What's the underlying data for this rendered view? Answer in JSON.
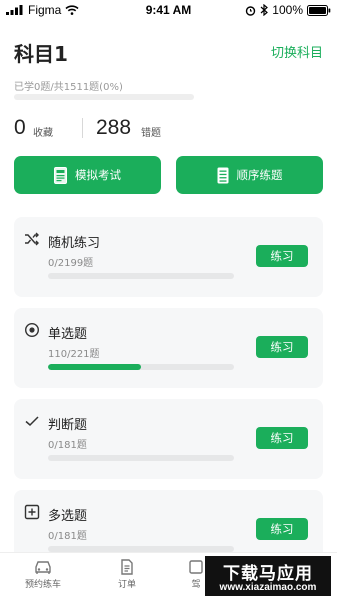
{
  "status_bar": {
    "carrier": "Figma",
    "time": "9:41 AM",
    "battery": "100%"
  },
  "header": {
    "title": "科目1",
    "switch_label": "切换科目",
    "progress_text": "已学0题/共1511题(0%)",
    "progress": 0
  },
  "stats": {
    "favorites_count": "0",
    "favorites_label": "收藏",
    "wrong_count": "288",
    "wrong_label": "错题"
  },
  "actions": {
    "mock_exam_label": "模拟考试",
    "sequential_label": "顺序练题"
  },
  "categories": [
    {
      "icon": "shuffle-icon",
      "title": "随机练习",
      "count": "0/2199题",
      "progress": 0,
      "button": "练习"
    },
    {
      "icon": "target-icon",
      "title": "单选题",
      "count": "110/221题",
      "progress": 0.5,
      "button": "练习"
    },
    {
      "icon": "check-icon",
      "title": "判断题",
      "count": "0/181题",
      "progress": 0,
      "button": "练习"
    },
    {
      "icon": "plus-square-icon",
      "title": "多选题",
      "count": "0/181题",
      "progress": 0,
      "button": "练习"
    }
  ],
  "tabbar": {
    "tabs": [
      {
        "label": "预约练车",
        "icon": "car-icon"
      },
      {
        "label": "订单",
        "icon": "document-icon"
      },
      {
        "label": "驾",
        "icon": "book-icon"
      }
    ]
  },
  "watermark": {
    "line1": "下载马应用",
    "line2": "www.xiazaimao.com"
  },
  "colors": {
    "accent": "#1bae5b",
    "card_bg": "#f6f7f8",
    "track": "#e6e7e8"
  }
}
